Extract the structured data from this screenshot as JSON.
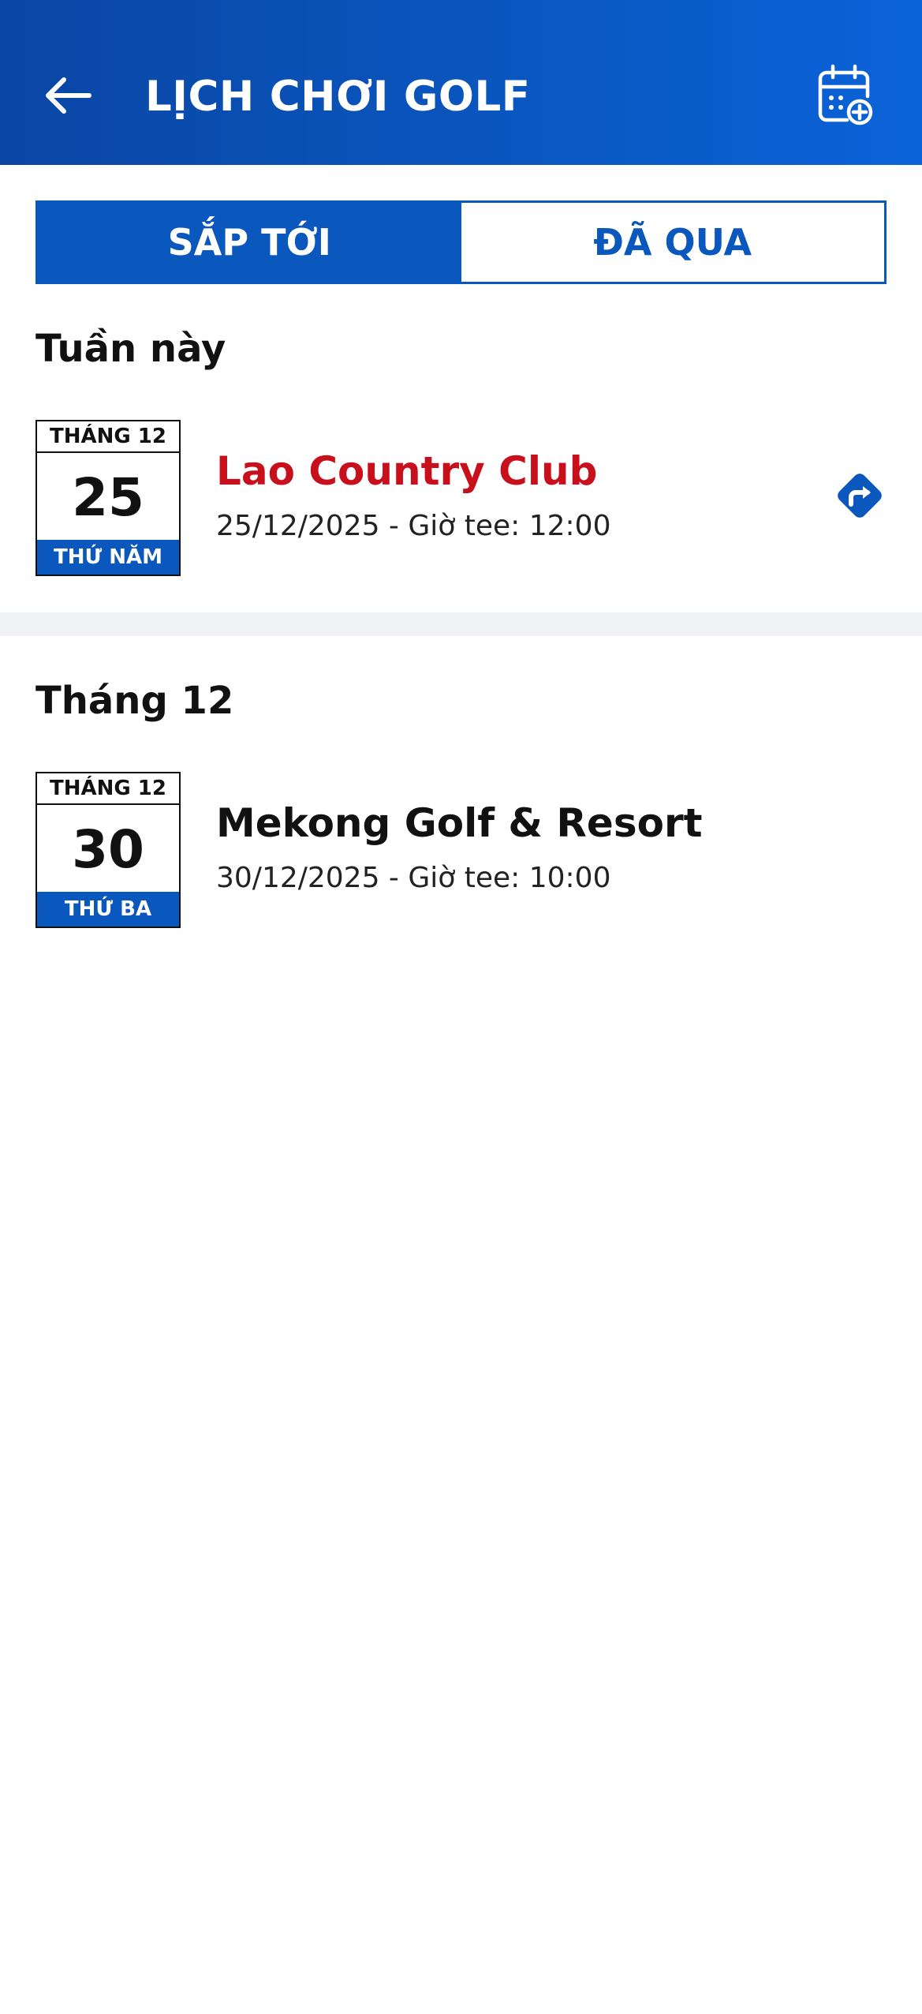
{
  "header": {
    "title": "LỊCH CHƠI GOLF",
    "back_icon": "arrow-left-icon",
    "add_icon": "calendar-add-icon"
  },
  "tabs": [
    {
      "label": "SẮP TỚI",
      "active": true
    },
    {
      "label": "ĐÃ QUA",
      "active": false
    }
  ],
  "sections": [
    {
      "title": "Tuần này",
      "events": [
        {
          "month": "THÁNG 12",
          "day": "25",
          "weekday": "THỨ NĂM",
          "name": "Lao Country Club",
          "meta": "25/12/2025 - Giờ tee: 12:00",
          "name_color": "#c8101c",
          "action_icon": "directions-icon"
        }
      ]
    },
    {
      "title": "Tháng 12",
      "events": [
        {
          "month": "THÁNG 12",
          "day": "30",
          "weekday": "THỨ BA",
          "name": "Mekong Golf & Resort",
          "meta": "30/12/2025 - Giờ tee: 10:00",
          "name_color": "#111111"
        }
      ]
    }
  ],
  "colors": {
    "primary": "#0a57bd",
    "highlight": "#c8101c",
    "divider": "#eff1f5"
  }
}
